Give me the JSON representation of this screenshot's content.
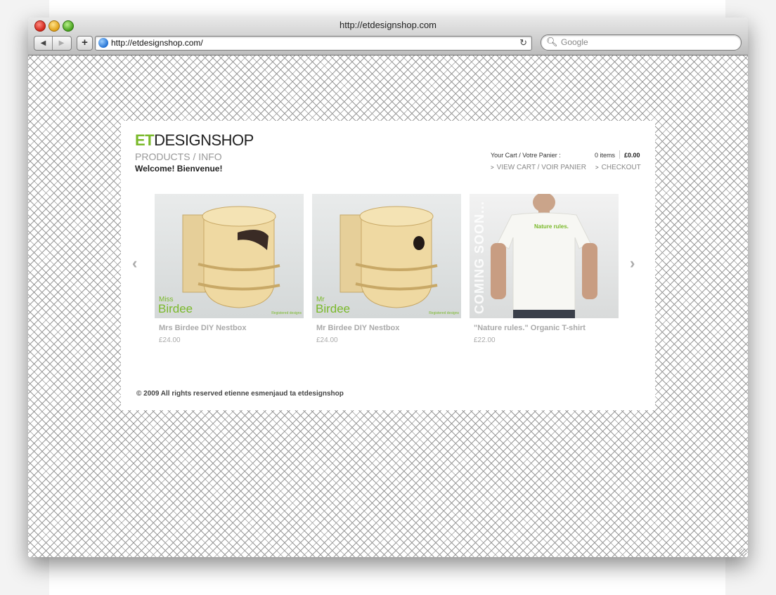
{
  "window": {
    "title": "http://etdesignshop.com"
  },
  "toolbar": {
    "back_icon": "back-arrow-icon",
    "forward_icon": "forward-arrow-icon",
    "add_label": "+",
    "url": "http://etdesignshop.com/",
    "reload_icon": "reload-icon",
    "search_placeholder": "Google"
  },
  "site": {
    "logo_prefix": "ET",
    "logo_rest": "DESIGNSHOP",
    "accent_color": "#7ab92a",
    "nav": "PRODUCTS / INFO",
    "welcome": "Welcome! Bienvenue!",
    "cart": {
      "label": "Your Cart / Votre Panier :",
      "items": "0 items",
      "total": "£0.00",
      "view_cart": "VIEW CART / VOIR PANIER",
      "checkout": "CHECKOUT"
    },
    "prev_arrow": "‹",
    "next_arrow": "›",
    "products": [
      {
        "name": "Mrs Birdee DIY Nestbox",
        "price": "£24.00",
        "overlay_small": "Miss",
        "overlay_big": "Birdee",
        "overlay_note": "Registered designs"
      },
      {
        "name": "Mr Birdee DIY Nestbox",
        "price": "£24.00",
        "overlay_small": "Mr",
        "overlay_big": "Birdee",
        "overlay_note": "Registered designs"
      },
      {
        "name": "\"Nature rules.\" Organic T-shirt",
        "price": "£22.00",
        "overlay_banner": "COMING SOON...",
        "shirt_text": "Nature rules."
      }
    ],
    "footer": "© 2009 All rights reserved etienne esmenjaud ta etdesignshop"
  }
}
